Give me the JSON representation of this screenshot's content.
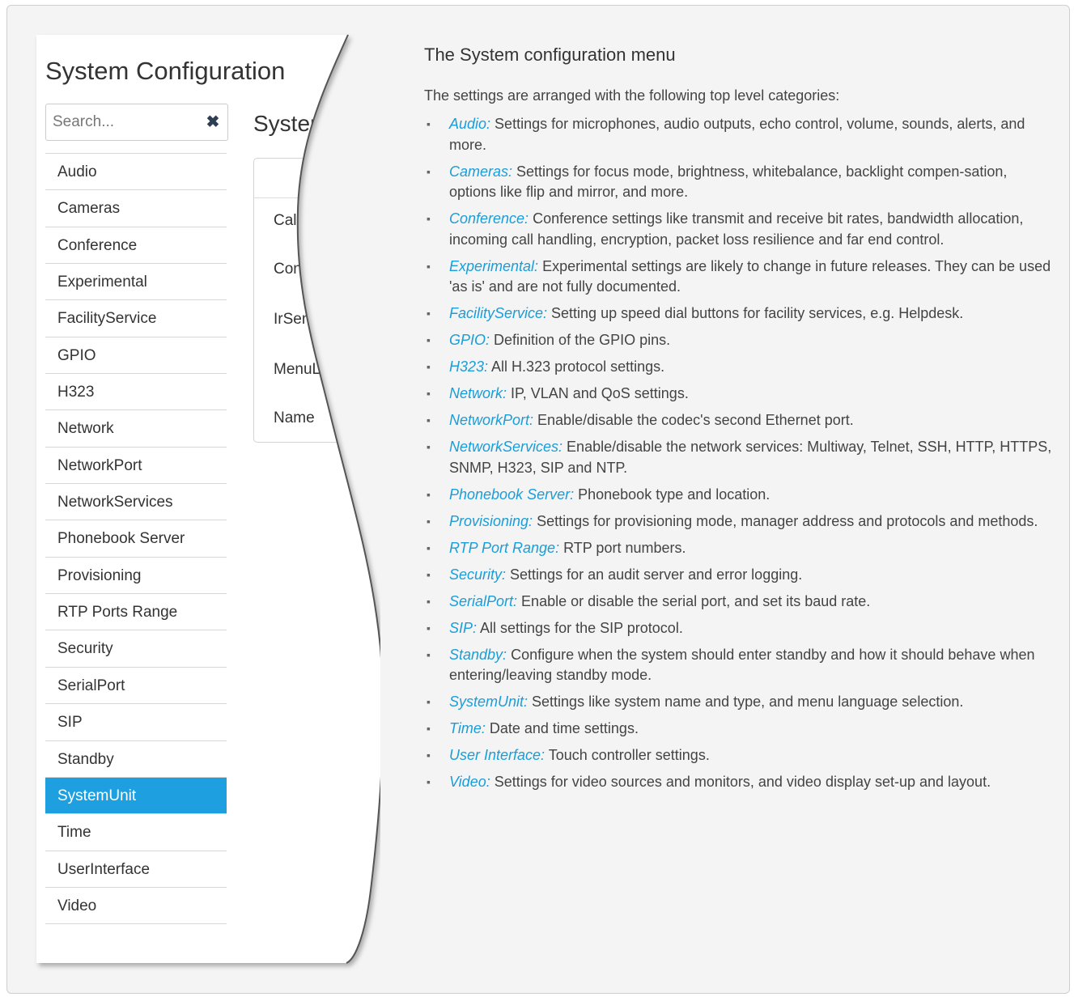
{
  "screenshot": {
    "title": "System Configuration",
    "search_placeholder": "Search...",
    "categories": [
      {
        "label": "Audio"
      },
      {
        "label": "Cameras"
      },
      {
        "label": "Conference"
      },
      {
        "label": "Experimental"
      },
      {
        "label": "FacilityService"
      },
      {
        "label": "GPIO"
      },
      {
        "label": "H323"
      },
      {
        "label": "Network"
      },
      {
        "label": "NetworkPort"
      },
      {
        "label": "NetworkServices"
      },
      {
        "label": "Phonebook Server"
      },
      {
        "label": "Provisioning"
      },
      {
        "label": "RTP Ports Range"
      },
      {
        "label": "Security"
      },
      {
        "label": "SerialPort"
      },
      {
        "label": "SIP"
      },
      {
        "label": "Standby"
      },
      {
        "label": "SystemUnit",
        "active": true
      },
      {
        "label": "Time"
      },
      {
        "label": "UserInterface"
      },
      {
        "label": "Video"
      }
    ],
    "section_title": "SystemUnit",
    "panel_rows": [
      {
        "label": "CallLogging"
      },
      {
        "label": "ContactInfo"
      },
      {
        "label": "IrSensor"
      },
      {
        "label": "MenuLanguage"
      },
      {
        "label": "Name"
      }
    ],
    "accent_color": "#1ea0e0"
  },
  "doc": {
    "title": "The System configuration menu",
    "intro": "The settings are arranged with the following top level categories:",
    "items": [
      {
        "term": "Audio:",
        "desc": " Settings for microphones, audio outputs, echo control, volume, sounds, alerts, and more."
      },
      {
        "term": "Cameras:",
        "desc": " Settings for focus mode, brightness, whitebalance, backlight compen-sation, options like flip and mirror, and more."
      },
      {
        "term": "Conference:",
        "desc": " Conference settings like transmit and receive bit rates, bandwidth allocation, incoming call handling, encryption, packet loss resilience and far end control."
      },
      {
        "term": "Experimental:",
        "desc": " Experimental settings are likely to change in future releases. They can be used 'as is' and are not fully documented."
      },
      {
        "term": "FacilityService:",
        "desc": " Setting up speed dial buttons for facility services, e.g. Helpdesk."
      },
      {
        "term": "GPIO:",
        "desc": " Definition of the GPIO pins."
      },
      {
        "term": "H323:",
        "desc": " All H.323 protocol settings."
      },
      {
        "term": "Network:",
        "desc": " IP, VLAN and QoS settings."
      },
      {
        "term": "NetworkPort:",
        "desc": " Enable/disable the codec's second Ethernet port."
      },
      {
        "term": "NetworkServices:",
        "desc": " Enable/disable the network services: Multiway, Telnet, SSH, HTTP, HTTPS, SNMP, H323, SIP and NTP."
      },
      {
        "term": "Phonebook Server:",
        "desc": " Phonebook type and location."
      },
      {
        "term": "Provisioning:",
        "desc": " Settings for provisioning mode, manager address and protocols and methods."
      },
      {
        "term": "RTP Port Range:",
        "desc": " RTP port numbers."
      },
      {
        "term": "Security:",
        "desc": " Settings for an audit server and error logging."
      },
      {
        "term": "SerialPort:",
        "desc": " Enable or disable the serial port, and set its baud rate."
      },
      {
        "term": "SIP:",
        "desc": " All settings for the SIP protocol."
      },
      {
        "term": "Standby:",
        "desc": " Configure when the system should enter standby and how it should behave when entering/leaving standby mode."
      },
      {
        "term": "SystemUnit:",
        "desc": " Settings like system name and type, and menu language selection."
      },
      {
        "term": "Time:",
        "desc": " Date and time settings."
      },
      {
        "term": "User Interface:",
        "desc": " Touch controller settings."
      },
      {
        "term": "Video:",
        "desc": " Settings for video sources and monitors, and video display set-up and layout."
      }
    ],
    "term_color": "#1a9dd8"
  }
}
